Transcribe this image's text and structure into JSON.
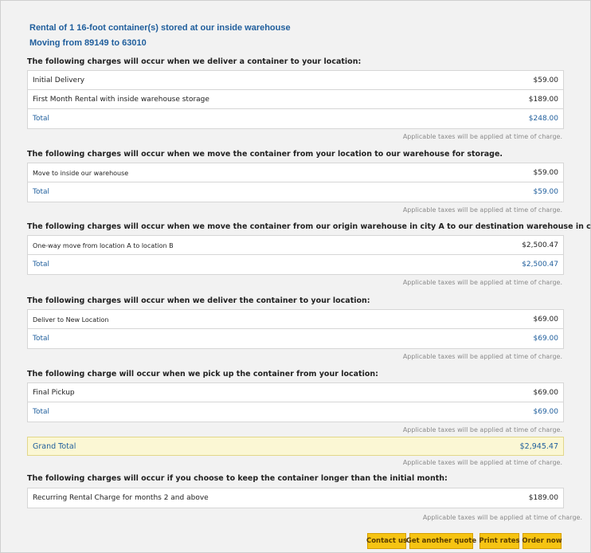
{
  "header": {
    "title": "Rental of 1 16-foot container(s) stored at our inside warehouse",
    "route": "Moving from 89149 to 63010"
  },
  "tax_note": "Applicable taxes will be applied at time of charge.",
  "sections": [
    {
      "intro": "The following charges will occur when we deliver a container to your location:",
      "items": [
        {
          "label": "Initial Delivery",
          "amount": "$59.00"
        },
        {
          "label": "First Month Rental with inside warehouse storage",
          "amount": "$189.00"
        }
      ],
      "total_label": "Total",
      "total": "$248.00"
    },
    {
      "intro": "The following charges will occur when we move the container from your location to our warehouse for storage.",
      "items": [
        {
          "label": "Move to inside our warehouse",
          "amount": "$59.00"
        }
      ],
      "total_label": "Total",
      "total": "$59.00"
    },
    {
      "intro": "The following charges will occur when we move the container from our origin warehouse in city A to our destination warehouse in city B:",
      "items": [
        {
          "label": "One-way move from location A to location B",
          "amount": "$2,500.47"
        }
      ],
      "total_label": "Total",
      "total": "$2,500.47"
    },
    {
      "intro": "The following charges will occur when we deliver the container to your location:",
      "items": [
        {
          "label": "Deliver to New Location",
          "amount": "$69.00"
        }
      ],
      "total_label": "Total",
      "total": "$69.00"
    },
    {
      "intro": "The following charge will occur when we pick up the container from your location:",
      "items": [
        {
          "label": "Final Pickup",
          "amount": "$69.00"
        }
      ],
      "total_label": "Total",
      "total": "$69.00"
    }
  ],
  "grand_total": {
    "label": "Grand Total",
    "amount": "$2,945.47"
  },
  "recurring": {
    "intro": "The following charges will occur if you choose to keep the container longer than the initial month:",
    "label": "Recurring Rental Charge for months 2 and above",
    "amount": "$189.00"
  },
  "buttons": {
    "contact": "Contact us",
    "quote": "Get another quote",
    "print": "Print rates",
    "order": "Order now"
  },
  "colors": {
    "accent": "#1f5e9c",
    "button": "#f6c413",
    "grand_total_bg": "#fbf7d4"
  }
}
